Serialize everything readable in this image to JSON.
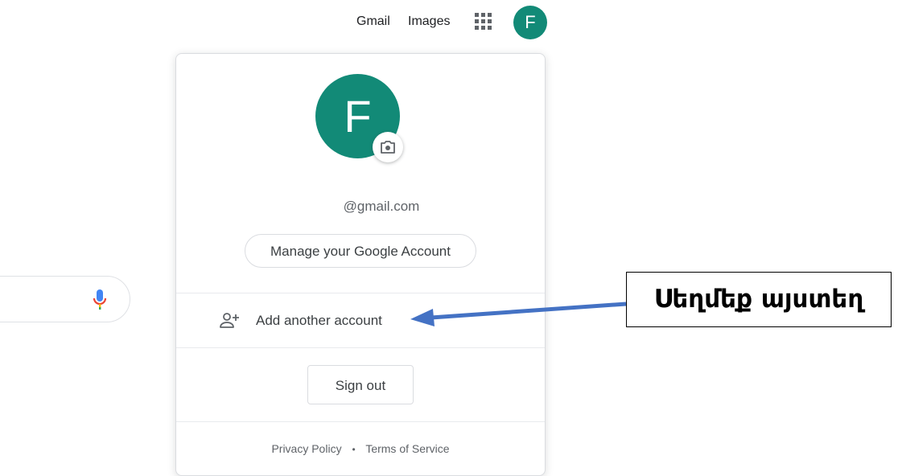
{
  "header": {
    "gmail_label": "Gmail",
    "images_label": "Images",
    "apps_icon": "apps-grid-icon",
    "avatar_letter": "F"
  },
  "account_panel": {
    "avatar_letter": "F",
    "camera_icon": "camera-icon",
    "email": "@gmail.com",
    "manage_button_label": "Manage your Google Account",
    "add_account_icon": "person-add-icon",
    "add_account_label": "Add another account",
    "sign_out_label": "Sign out",
    "footer": {
      "privacy_label": "Privacy Policy",
      "separator": "•",
      "terms_label": "Terms of Service"
    }
  },
  "search": {
    "mic_icon": "microphone-icon"
  },
  "annotation": {
    "callout_text": "Սեղմեք այստեղ",
    "arrow_color": "#4472c4"
  },
  "colors": {
    "avatar_bg": "#128a77",
    "text_primary": "#3c4043",
    "text_secondary": "#5f6368",
    "border": "#dadce0"
  }
}
